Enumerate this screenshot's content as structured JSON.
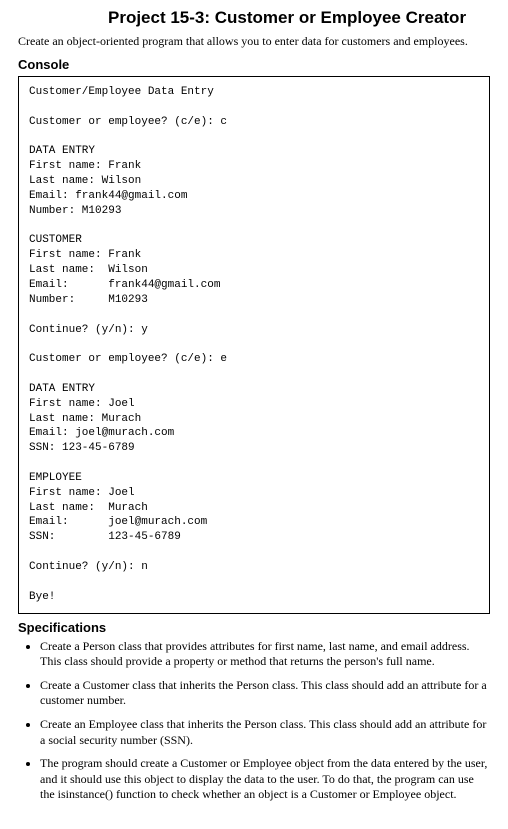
{
  "title": "Project 15-3: Customer or Employee Creator",
  "intro": "Create an object-oriented program that allows you to enter data for customers and employees.",
  "console_heading": "Console",
  "console_text": "Customer/Employee Data Entry\n\nCustomer or employee? (c/e): c\n\nDATA ENTRY\nFirst name: Frank\nLast name: Wilson\nEmail: frank44@gmail.com\nNumber: M10293\n\nCUSTOMER\nFirst name: Frank\nLast name:  Wilson\nEmail:      frank44@gmail.com\nNumber:     M10293\n\nContinue? (y/n): y\n\nCustomer or employee? (c/e): e\n\nDATA ENTRY\nFirst name: Joel\nLast name: Murach\nEmail: joel@murach.com\nSSN: 123-45-6789\n\nEMPLOYEE\nFirst name: Joel\nLast name:  Murach\nEmail:      joel@murach.com\nSSN:        123-45-6789\n\nContinue? (y/n): n\n\nBye!",
  "specs_heading": "Specifications",
  "specs": [
    "Create a Person class that provides attributes for first name, last name, and email address. This class should provide a property or method that returns the person's full name.",
    "Create a Customer class that inherits the Person class. This class should add an attribute for a customer number.",
    "Create an Employee class that inherits the Person class. This class should add an attribute for a social security number (SSN).",
    "The program should create a Customer or Employee object from the data entered by the user, and it should use this object to display the data to the user. To do that, the program can use the isinstance() function to check whether an object is a Customer or Employee object."
  ]
}
